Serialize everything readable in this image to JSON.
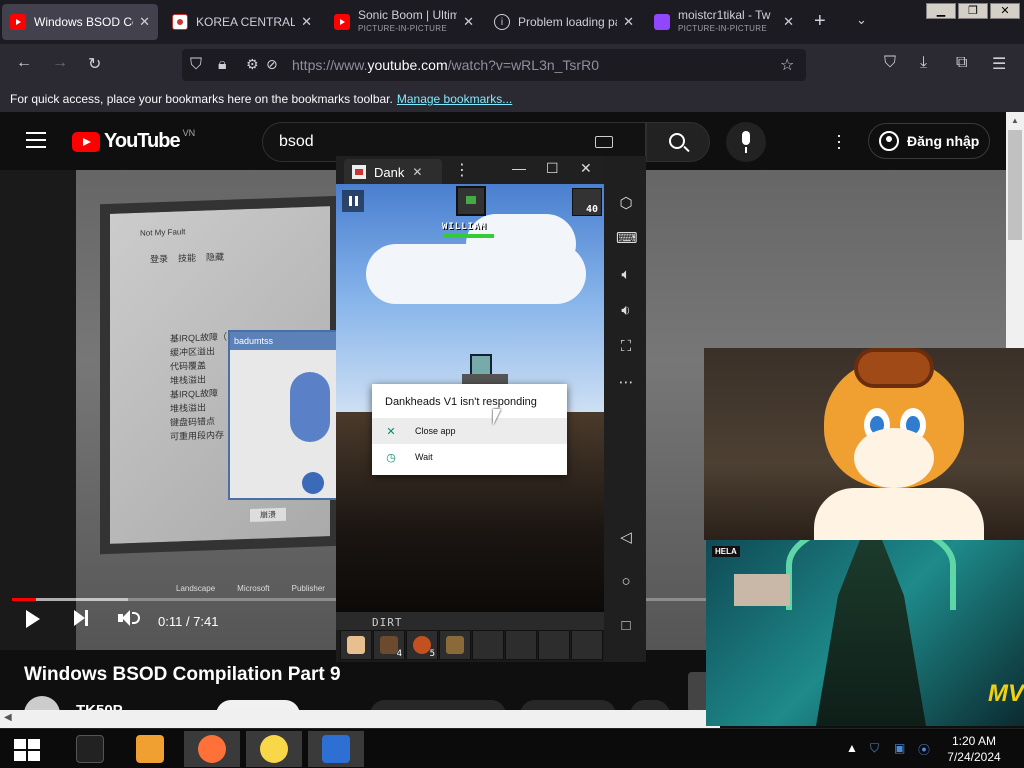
{
  "browser": {
    "tabs": [
      {
        "label": "Windows BSOD Co",
        "sub": "",
        "icon": "youtube-icon",
        "active": true
      },
      {
        "label": "KOREA CENTRAL T",
        "sub": "",
        "icon": "korea-flag-icon",
        "active": false
      },
      {
        "label": "Sonic Boom | Ultim",
        "sub": "PICTURE-IN-PICTURE",
        "icon": "youtube-icon",
        "active": false
      },
      {
        "label": "Problem loading pa",
        "sub": "",
        "icon": "info-icon",
        "active": false
      },
      {
        "label": "moistcr1tikal - Tw",
        "sub": "PICTURE-IN-PICTURE",
        "icon": "twitch-icon",
        "active": false
      }
    ],
    "new_tab": "+",
    "url_prefix": "https://www.",
    "url_domain": "youtube.com",
    "url_path": "/watch?v=wRL3n_TsrR0",
    "bookmarks_text": "For quick access, place your bookmarks here on the bookmarks toolbar.",
    "bookmarks_link": "Manage bookmarks..."
  },
  "youtube": {
    "logo_text": "YouTube",
    "country_code": "VN",
    "search_query": "bsod",
    "signin_label": "Đăng nhập",
    "video_title": "Windows BSOD Compilation Part 9",
    "channel_name": "TK50P",
    "time_label": "0:11 / 7:41",
    "progress_fraction": 0.024,
    "buffer_fraction": 0.117,
    "player_dialog": {
      "title": "badumtss",
      "side_text": "Not My Fault",
      "menu": [
        "登录",
        "技能",
        "隐藏"
      ],
      "list_items": [
        "基IRQL故障（",
        "缓冲区溢出",
        "代码覆盖",
        "堆栈溢出",
        "基IRQL故障",
        "堆栈溢出",
        "键盘码错点",
        "可重用段内存"
      ],
      "button": "崩溃",
      "desktop_icons": [
        "Landscape",
        "Microsoft",
        "Publisher"
      ]
    }
  },
  "emulator": {
    "tab_title": "Dank",
    "player_name": "WILLIAM",
    "ammo": "40",
    "inventory_label": "DIRT",
    "inventory_counts": [
      "",
      "4",
      "5",
      "",
      "",
      "",
      "",
      ""
    ],
    "anr_dialog": {
      "title": "Dankheads V1 isn't responding",
      "options": [
        {
          "label": "Close app",
          "icon": "close-icon"
        },
        {
          "label": "Wait",
          "icon": "clock-icon"
        }
      ]
    }
  },
  "pip": {
    "hela_tag": "HELA",
    "mv_logo": "MV"
  },
  "taskbar": {
    "time": "1:20 AM",
    "date": "7/24/2024"
  },
  "colors": {
    "youtube_red": "#ff0000",
    "browser_bg": "#1c1b22",
    "emu_green": "#0a8a6f"
  }
}
